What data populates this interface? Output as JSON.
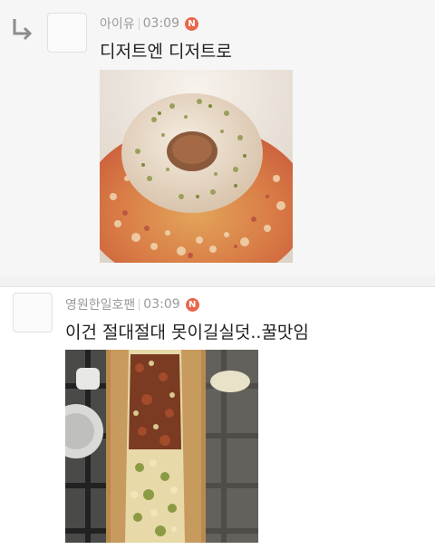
{
  "comments": [
    {
      "author": "아이유",
      "time": "03:09",
      "badge": "N",
      "text": "디저트엔 디저트로",
      "is_reply": true,
      "image_icon": "dessert-photo"
    },
    {
      "author": "영원한일호팬",
      "time": "03:09",
      "badge": "N",
      "text": "이건 절대절대 못이길실덧..꿀맛임",
      "is_reply": false,
      "image_icon": "flatbread-photo"
    }
  ],
  "colors": {
    "badge": "#e8674c",
    "meta_text": "#9a9a9a",
    "body_text": "#222222"
  }
}
